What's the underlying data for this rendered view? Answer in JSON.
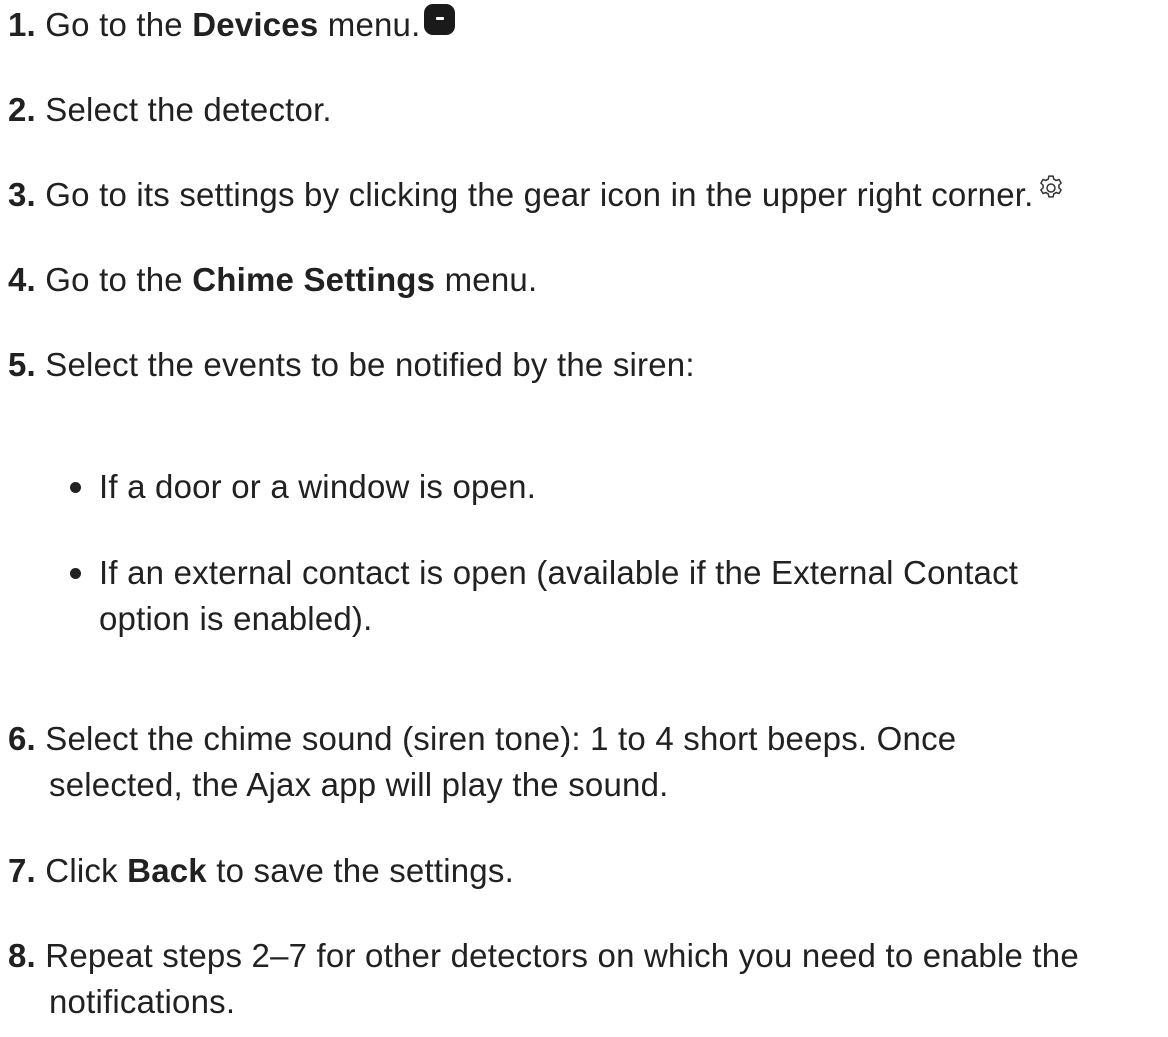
{
  "steps": [
    {
      "num": "1.",
      "before": " Go to the ",
      "bold": "Devices",
      "after": " menu.",
      "icon": "devices-icon"
    },
    {
      "num": "2.",
      "text": " Select the detector."
    },
    {
      "num": "3.",
      "text": " Go to its settings by clicking the gear icon in the upper right corner.",
      "icon": "gear-icon"
    },
    {
      "num": "4.",
      "before": " Go to the ",
      "bold": "Chime Settings",
      "after": " menu."
    },
    {
      "num": "5.",
      "text": " Select the events to be notified by the siren:"
    },
    {
      "num": "6.",
      "text": " Select the chime sound (siren tone): 1 to 4 short beeps. Once",
      "text2": "selected, the Ajax app will play the sound."
    },
    {
      "num": "7.",
      "before": " Click ",
      "bold": "Back",
      "after": " to save the settings."
    },
    {
      "num": "8.",
      "text": " Repeat steps 2–7 for other detectors on which you need to enable the",
      "text2": "notifications."
    }
  ],
  "bullets": [
    {
      "text": "If a door or a window is open."
    },
    {
      "text": "If an external contact is open (available if the External Contact",
      "text2": "option is enabled)."
    }
  ]
}
